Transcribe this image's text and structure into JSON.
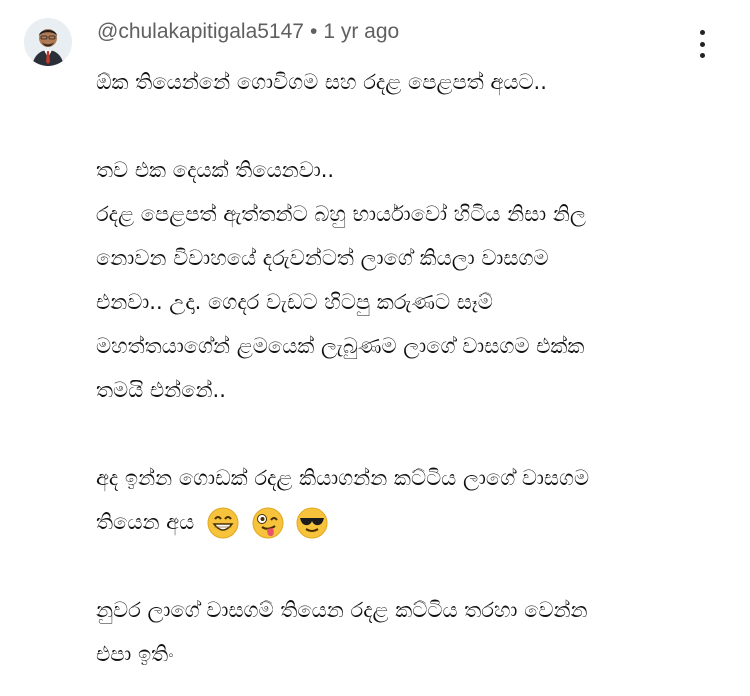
{
  "comment": {
    "author": "@chulakapitigala5147",
    "separator": "•",
    "timestamp": "1 yr ago",
    "lines": [
      "ඕක තියෙන්නේ ගොවිගම සහ රදළ පෙළපත් අයට..",
      "",
      "තව එක දෙයක් තියෙනවා..",
      "රදළ පෙළපත් ඇත්තන්ට බහු භාර්යාවෝ හිටිය නිසා නිල",
      "නොවන විවාහයේ දරුවන්ටත් ලාගේ කියලා වාසගම",
      "එනවා.. උදා. ගෙදර වැඩට හිටපු කරුණට සෑම්",
      "මහත්තයාගේන් ළමයෙක් ලැබුණම ලාගේ වාසගම එක්ක",
      "තමයි එන්නේ..",
      "",
      "අද ඉන්න ගොඩක් රදළ කියාගන්න කට්ටිය ලාගේ වාසගම",
      "තියෙන අය",
      "",
      "නුවර ලාගේ වාසගම් තියෙන රදළ කට්ටිය තරහා වෙන්න",
      "එපා ඉතිං"
    ],
    "emojis": [
      "grinning-face-icon",
      "winking-tongue-face-icon",
      "sunglasses-face-icon"
    ]
  },
  "colors": {
    "meta": "#606060",
    "text": "#0f0f0f",
    "emoji": "#f7c33c"
  }
}
